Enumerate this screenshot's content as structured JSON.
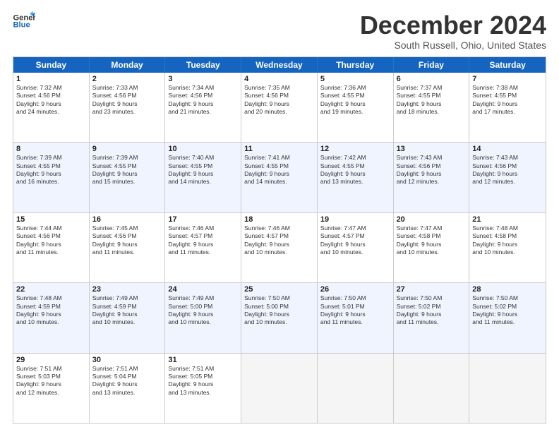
{
  "header": {
    "logo_general": "General",
    "logo_blue": "Blue",
    "month_title": "December 2024",
    "location": "South Russell, Ohio, United States"
  },
  "days_of_week": [
    "Sunday",
    "Monday",
    "Tuesday",
    "Wednesday",
    "Thursday",
    "Friday",
    "Saturday"
  ],
  "rows": [
    [
      {
        "day": "1",
        "lines": [
          "Sunrise: 7:32 AM",
          "Sunset: 4:56 PM",
          "Daylight: 9 hours",
          "and 24 minutes."
        ]
      },
      {
        "day": "2",
        "lines": [
          "Sunrise: 7:33 AM",
          "Sunset: 4:56 PM",
          "Daylight: 9 hours",
          "and 23 minutes."
        ]
      },
      {
        "day": "3",
        "lines": [
          "Sunrise: 7:34 AM",
          "Sunset: 4:56 PM",
          "Daylight: 9 hours",
          "and 21 minutes."
        ]
      },
      {
        "day": "4",
        "lines": [
          "Sunrise: 7:35 AM",
          "Sunset: 4:56 PM",
          "Daylight: 9 hours",
          "and 20 minutes."
        ]
      },
      {
        "day": "5",
        "lines": [
          "Sunrise: 7:36 AM",
          "Sunset: 4:55 PM",
          "Daylight: 9 hours",
          "and 19 minutes."
        ]
      },
      {
        "day": "6",
        "lines": [
          "Sunrise: 7:37 AM",
          "Sunset: 4:55 PM",
          "Daylight: 9 hours",
          "and 18 minutes."
        ]
      },
      {
        "day": "7",
        "lines": [
          "Sunrise: 7:38 AM",
          "Sunset: 4:55 PM",
          "Daylight: 9 hours",
          "and 17 minutes."
        ]
      }
    ],
    [
      {
        "day": "8",
        "lines": [
          "Sunrise: 7:39 AM",
          "Sunset: 4:55 PM",
          "Daylight: 9 hours",
          "and 16 minutes."
        ]
      },
      {
        "day": "9",
        "lines": [
          "Sunrise: 7:39 AM",
          "Sunset: 4:55 PM",
          "Daylight: 9 hours",
          "and 15 minutes."
        ]
      },
      {
        "day": "10",
        "lines": [
          "Sunrise: 7:40 AM",
          "Sunset: 4:55 PM",
          "Daylight: 9 hours",
          "and 14 minutes."
        ]
      },
      {
        "day": "11",
        "lines": [
          "Sunrise: 7:41 AM",
          "Sunset: 4:55 PM",
          "Daylight: 9 hours",
          "and 14 minutes."
        ]
      },
      {
        "day": "12",
        "lines": [
          "Sunrise: 7:42 AM",
          "Sunset: 4:55 PM",
          "Daylight: 9 hours",
          "and 13 minutes."
        ]
      },
      {
        "day": "13",
        "lines": [
          "Sunrise: 7:43 AM",
          "Sunset: 4:56 PM",
          "Daylight: 9 hours",
          "and 12 minutes."
        ]
      },
      {
        "day": "14",
        "lines": [
          "Sunrise: 7:43 AM",
          "Sunset: 4:56 PM",
          "Daylight: 9 hours",
          "and 12 minutes."
        ]
      }
    ],
    [
      {
        "day": "15",
        "lines": [
          "Sunrise: 7:44 AM",
          "Sunset: 4:56 PM",
          "Daylight: 9 hours",
          "and 11 minutes."
        ]
      },
      {
        "day": "16",
        "lines": [
          "Sunrise: 7:45 AM",
          "Sunset: 4:56 PM",
          "Daylight: 9 hours",
          "and 11 minutes."
        ]
      },
      {
        "day": "17",
        "lines": [
          "Sunrise: 7:46 AM",
          "Sunset: 4:57 PM",
          "Daylight: 9 hours",
          "and 11 minutes."
        ]
      },
      {
        "day": "18",
        "lines": [
          "Sunrise: 7:46 AM",
          "Sunset: 4:57 PM",
          "Daylight: 9 hours",
          "and 10 minutes."
        ]
      },
      {
        "day": "19",
        "lines": [
          "Sunrise: 7:47 AM",
          "Sunset: 4:57 PM",
          "Daylight: 9 hours",
          "and 10 minutes."
        ]
      },
      {
        "day": "20",
        "lines": [
          "Sunrise: 7:47 AM",
          "Sunset: 4:58 PM",
          "Daylight: 9 hours",
          "and 10 minutes."
        ]
      },
      {
        "day": "21",
        "lines": [
          "Sunrise: 7:48 AM",
          "Sunset: 4:58 PM",
          "Daylight: 9 hours",
          "and 10 minutes."
        ]
      }
    ],
    [
      {
        "day": "22",
        "lines": [
          "Sunrise: 7:48 AM",
          "Sunset: 4:59 PM",
          "Daylight: 9 hours",
          "and 10 minutes."
        ]
      },
      {
        "day": "23",
        "lines": [
          "Sunrise: 7:49 AM",
          "Sunset: 4:59 PM",
          "Daylight: 9 hours",
          "and 10 minutes."
        ]
      },
      {
        "day": "24",
        "lines": [
          "Sunrise: 7:49 AM",
          "Sunset: 5:00 PM",
          "Daylight: 9 hours",
          "and 10 minutes."
        ]
      },
      {
        "day": "25",
        "lines": [
          "Sunrise: 7:50 AM",
          "Sunset: 5:00 PM",
          "Daylight: 9 hours",
          "and 10 minutes."
        ]
      },
      {
        "day": "26",
        "lines": [
          "Sunrise: 7:50 AM",
          "Sunset: 5:01 PM",
          "Daylight: 9 hours",
          "and 11 minutes."
        ]
      },
      {
        "day": "27",
        "lines": [
          "Sunrise: 7:50 AM",
          "Sunset: 5:02 PM",
          "Daylight: 9 hours",
          "and 11 minutes."
        ]
      },
      {
        "day": "28",
        "lines": [
          "Sunrise: 7:50 AM",
          "Sunset: 5:02 PM",
          "Daylight: 9 hours",
          "and 11 minutes."
        ]
      }
    ],
    [
      {
        "day": "29",
        "lines": [
          "Sunrise: 7:51 AM",
          "Sunset: 5:03 PM",
          "Daylight: 9 hours",
          "and 12 minutes."
        ]
      },
      {
        "day": "30",
        "lines": [
          "Sunrise: 7:51 AM",
          "Sunset: 5:04 PM",
          "Daylight: 9 hours",
          "and 13 minutes."
        ]
      },
      {
        "day": "31",
        "lines": [
          "Sunrise: 7:51 AM",
          "Sunset: 5:05 PM",
          "Daylight: 9 hours",
          "and 13 minutes."
        ]
      },
      null,
      null,
      null,
      null
    ]
  ]
}
